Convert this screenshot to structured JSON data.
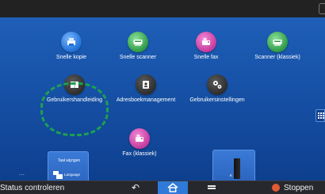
{
  "apps": {
    "snelle_kopie": {
      "label": "Snelle kopie",
      "icon": "copy-icon",
      "color": "#1f6fd6"
    },
    "snelle_scanner": {
      "label": "Snelle scanner",
      "icon": "scanner-icon",
      "color": "#2e9a45"
    },
    "snelle_fax": {
      "label": "Snelle fax",
      "icon": "fax-icon",
      "color": "#c53a9d"
    },
    "scanner_klassiek": {
      "label": "Scanner (klassiek)",
      "icon": "scanner-icon",
      "color": "#2e9a45"
    },
    "gebruikershandleiding": {
      "label": "Gebruikershandleiding",
      "icon": "book-icon",
      "color": "#2d2d2d"
    },
    "adresboekmanagement": {
      "label": "Adresboekmanagement",
      "icon": "address-book-icon",
      "color": "#2d2d2d"
    },
    "gebruikersinstellingen": {
      "label": "Gebruikersinstellingen",
      "icon": "gears-icon",
      "color": "#2d2d2d"
    },
    "fax_klassiek": {
      "label": "Fax (klassiek)",
      "icon": "fax-icon",
      "color": "#c53a9d"
    }
  },
  "widgets": {
    "language": {
      "title": "Taal wijzigen",
      "subtitle": "Language",
      "icon": "language-icon"
    },
    "toner": {
      "label": "K",
      "icon": "toner-icon"
    }
  },
  "bottom_bar": {
    "status_label": "Status controleren",
    "stop_label": "Stoppen",
    "back_icon": "back-icon",
    "home_icon": "home-icon",
    "menu_icon": "menu-icon",
    "stop_icon": "stop-icon"
  },
  "callout": {
    "color": "#1ca150",
    "style": "dashed"
  },
  "more_indicator": "..."
}
